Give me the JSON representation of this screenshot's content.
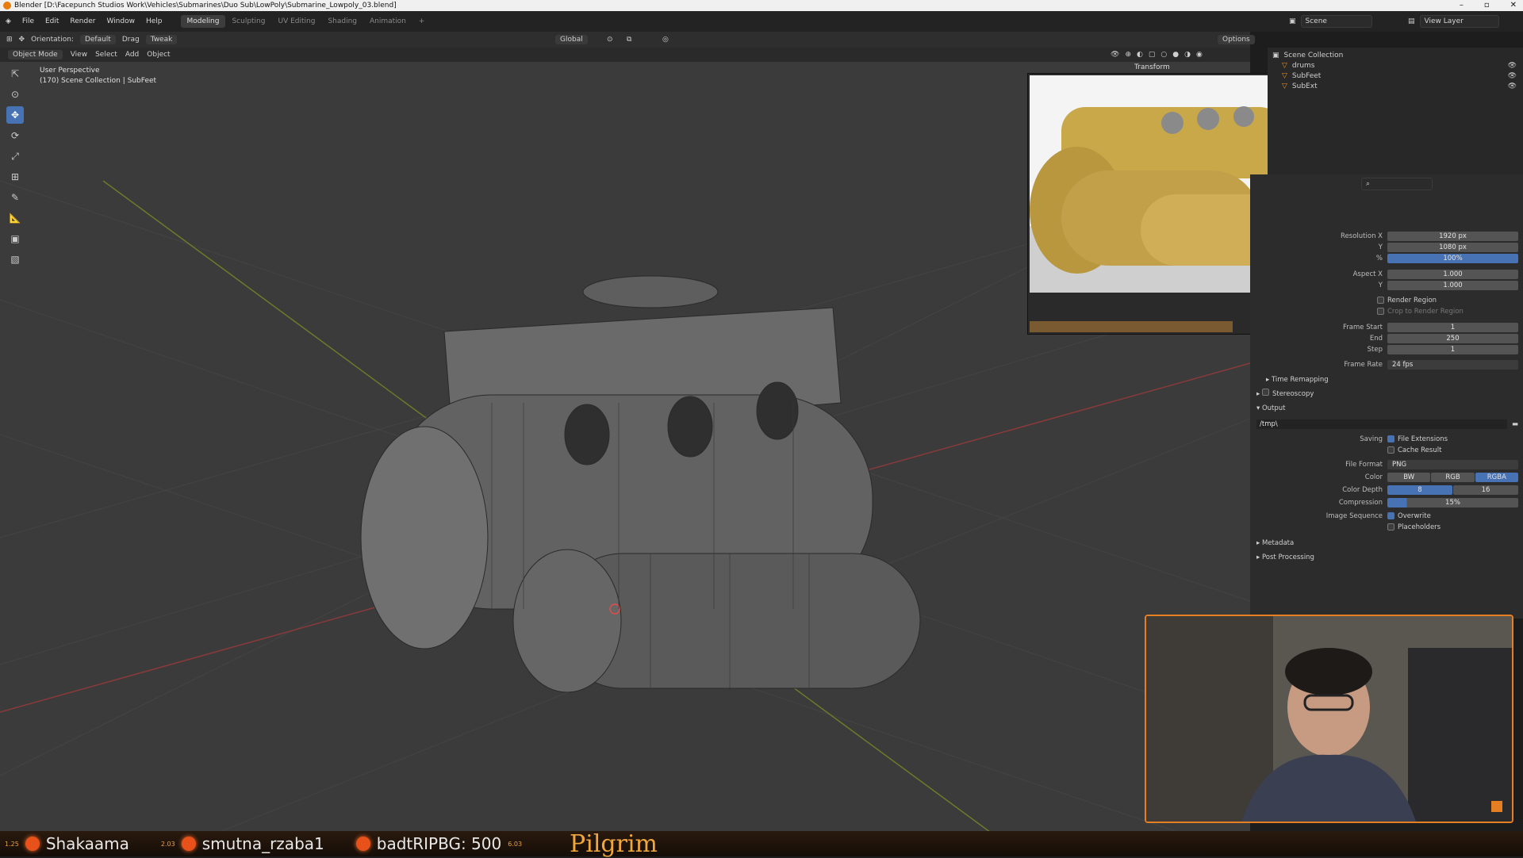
{
  "window": {
    "title": "Blender [D:\\Facepunch Studios Work\\Vehicles\\Submarines\\Duo Sub\\LowPoly\\Submarine_Lowpoly_03.blend]"
  },
  "menu": {
    "items": [
      "File",
      "Edit",
      "Render",
      "Window",
      "Help"
    ],
    "workspaces": [
      "Modeling",
      "Sculpting",
      "UV Editing",
      "Shading",
      "Animation"
    ],
    "add_workspace": "+",
    "scene_label": "Scene",
    "view_layer_label": "View Layer"
  },
  "toolheader": {
    "orientation_label": "Orientation:",
    "orientation_value": "Default",
    "drag_label": "Drag",
    "drag_value": "Tweak",
    "transform_orientation": "Global",
    "options_label": "Options"
  },
  "viewheader": {
    "mode": "Object Mode",
    "items": [
      "View",
      "Select",
      "Add",
      "Object"
    ]
  },
  "viewport": {
    "perspective": "User Perspective",
    "collection_info": "(170) Scene Collection | SubFeet",
    "transform_panel_label": "Transform"
  },
  "outliner": {
    "root": "Scene Collection",
    "rows": [
      "drums",
      "SubFeet",
      "SubExt"
    ]
  },
  "properties": {
    "resolution_x_label": "Resolution X",
    "resolution_x": "1920 px",
    "resolution_y_label": "Y",
    "resolution_y": "1080 px",
    "percent_label": "%",
    "percent": "100%",
    "aspect_x_label": "Aspect X",
    "aspect_x": "1.000",
    "aspect_y_label": "Y",
    "aspect_y": "1.000",
    "render_region": "Render Region",
    "crop_region": "Crop to Render Region",
    "frame_start_label": "Frame Start",
    "frame_start": "1",
    "end_label": "End",
    "end": "250",
    "step_label": "Step",
    "step": "1",
    "frame_rate_label": "Frame Rate",
    "frame_rate": "24 fps",
    "time_remapping": "Time Remapping",
    "stereoscopy": "Stereoscopy",
    "output": "Output",
    "output_path": "/tmp\\",
    "saving_label": "Saving",
    "file_extensions": "File Extensions",
    "cache_result": "Cache Result",
    "file_format_label": "File Format",
    "file_format": "PNG",
    "color_label": "Color",
    "color_bw": "BW",
    "color_rgb": "RGB",
    "color_rgba": "RGBA",
    "color_depth_label": "Color Depth",
    "depth_8": "8",
    "depth_16": "16",
    "compression_label": "Compression",
    "compression": "15%",
    "image_sequence_label": "Image Sequence",
    "overwrite": "Overwrite",
    "placeholders": "Placeholders",
    "metadata": "Metadata",
    "post_processing": "Post Processing"
  },
  "ticker": {
    "items": [
      {
        "small": "1.25",
        "name": "Shakaama"
      },
      {
        "small": "2.03",
        "name": "smutna_rzaba1"
      },
      {
        "small": "",
        "name": "badtRIPBG: 500"
      }
    ],
    "small_tail": "6.03",
    "brand": "Pilgrim"
  },
  "colors": {
    "accent": "#4772b3",
    "brand_orange": "#e67e22",
    "viewport_bg": "#3b3b3b"
  }
}
